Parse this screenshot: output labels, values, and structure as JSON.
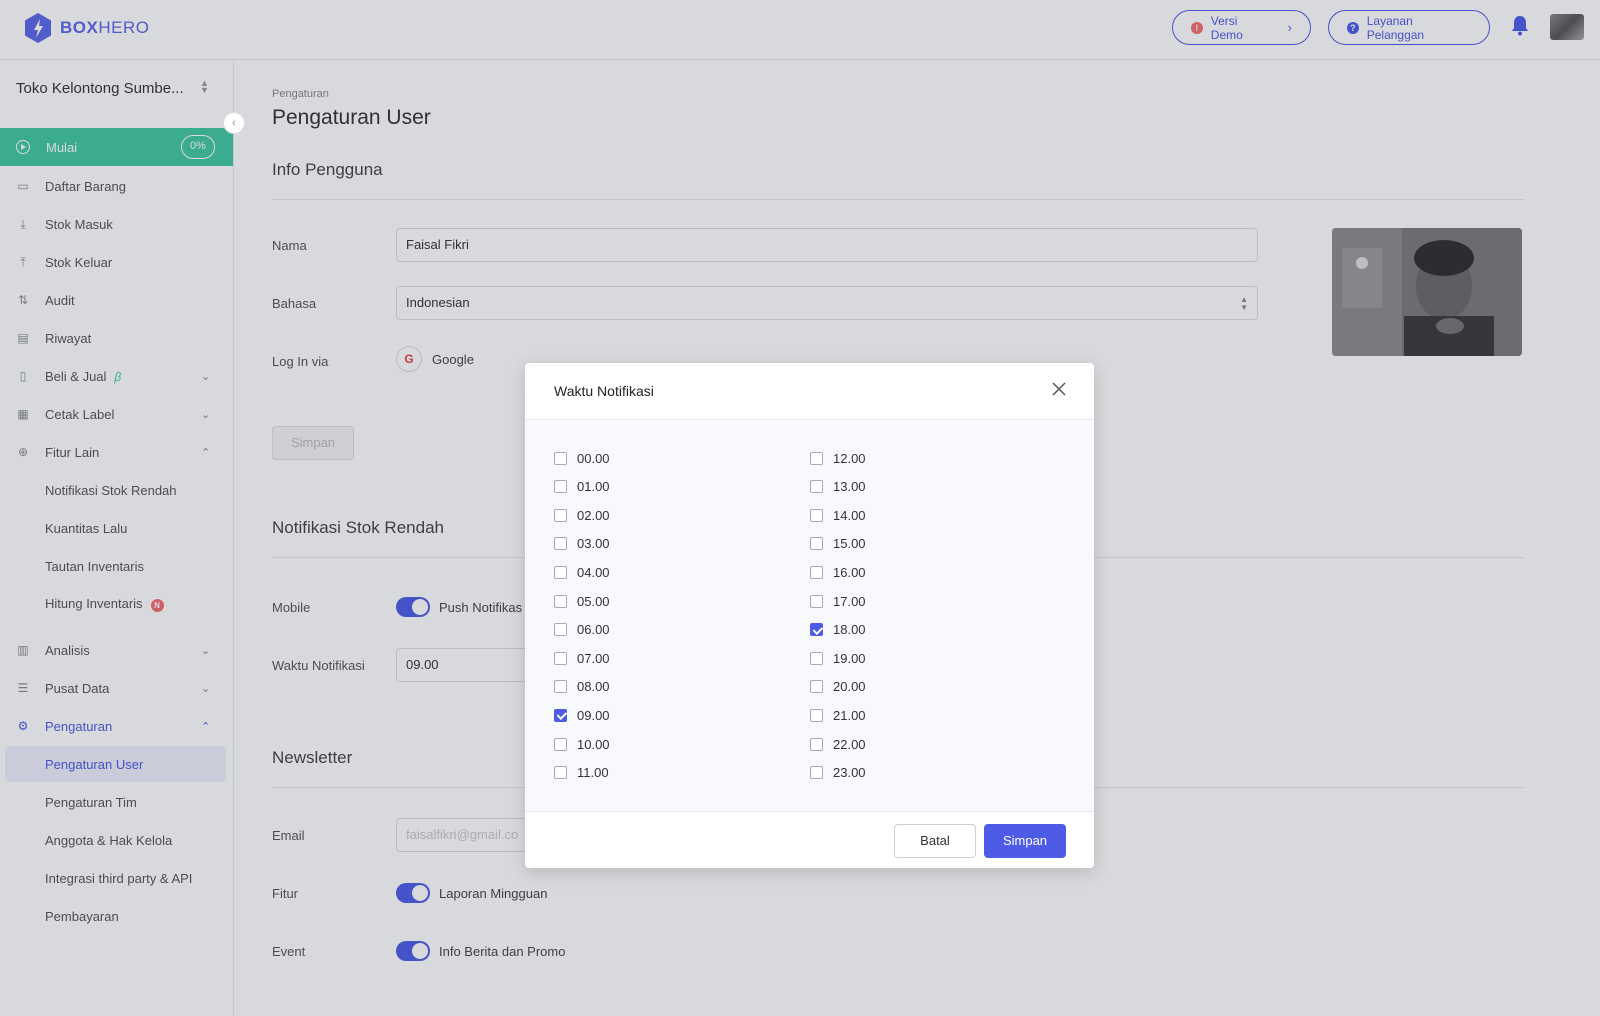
{
  "brand": {
    "name_bold": "BOX",
    "name_light": "HERO"
  },
  "header": {
    "demo_label": "Versi Demo",
    "support_label": "Layanan Pelanggan"
  },
  "sidebar": {
    "store_name": "Toko Kelontong Sumbe...",
    "start": {
      "label": "Mulai",
      "progress": "0%"
    },
    "items": [
      {
        "label": "Daftar Barang"
      },
      {
        "label": "Stok Masuk"
      },
      {
        "label": "Stok Keluar"
      },
      {
        "label": "Audit"
      },
      {
        "label": "Riwayat"
      },
      {
        "label": "Beli & Jual",
        "tag": "β"
      },
      {
        "label": "Cetak Label"
      },
      {
        "label": "Fitur Lain"
      },
      {
        "label": "Notifikasi Stok Rendah"
      },
      {
        "label": "Kuantitas Lalu"
      },
      {
        "label": "Tautan Inventaris"
      },
      {
        "label": "Hitung Inventaris",
        "badge": "N"
      },
      {
        "label": "Analisis"
      },
      {
        "label": "Pusat Data"
      },
      {
        "label": "Pengaturan"
      },
      {
        "label": "Pengaturan User"
      },
      {
        "label": "Pengaturan Tim"
      },
      {
        "label": "Anggota & Hak Kelola"
      },
      {
        "label": "Integrasi third party & API"
      },
      {
        "label": "Pembayaran"
      }
    ]
  },
  "main": {
    "breadcrumb": "Pengaturan",
    "title": "Pengaturan User",
    "user_info": {
      "title": "Info Pengguna",
      "name_label": "Nama",
      "name_value": "Faisal Fikri",
      "language_label": "Bahasa",
      "language_value": "Indonesian",
      "login_label": "Log In via",
      "login_provider": "Google",
      "google_glyph": "G",
      "save_label": "Simpan"
    },
    "low_stock": {
      "title": "Notifikasi Stok Rendah",
      "mobile_label": "Mobile",
      "push_label": "Push Notifikas",
      "time_label": "Waktu Notifikasi",
      "time_value": "09.00"
    },
    "newsletter": {
      "title": "Newsletter",
      "email_label": "Email",
      "email_value": "faisalfikri@gmail.co",
      "feature_label": "Fitur",
      "feature_toggle": "Laporan Mingguan",
      "event_label": "Event",
      "event_toggle": "Info Berita dan Promo"
    }
  },
  "modal": {
    "title": "Waktu Notifikasi",
    "hours": [
      {
        "label": "00.00",
        "checked": false
      },
      {
        "label": "01.00",
        "checked": false
      },
      {
        "label": "02.00",
        "checked": false
      },
      {
        "label": "03.00",
        "checked": false
      },
      {
        "label": "04.00",
        "checked": false
      },
      {
        "label": "05.00",
        "checked": false
      },
      {
        "label": "06.00",
        "checked": false
      },
      {
        "label": "07.00",
        "checked": false
      },
      {
        "label": "08.00",
        "checked": false
      },
      {
        "label": "09.00",
        "checked": true
      },
      {
        "label": "10.00",
        "checked": false
      },
      {
        "label": "11.00",
        "checked": false
      },
      {
        "label": "12.00",
        "checked": false
      },
      {
        "label": "13.00",
        "checked": false
      },
      {
        "label": "14.00",
        "checked": false
      },
      {
        "label": "15.00",
        "checked": false
      },
      {
        "label": "16.00",
        "checked": false
      },
      {
        "label": "17.00",
        "checked": false
      },
      {
        "label": "18.00",
        "checked": true
      },
      {
        "label": "19.00",
        "checked": false
      },
      {
        "label": "20.00",
        "checked": false
      },
      {
        "label": "21.00",
        "checked": false
      },
      {
        "label": "22.00",
        "checked": false
      },
      {
        "label": "23.00",
        "checked": false
      }
    ],
    "cancel_label": "Batal",
    "save_label": "Simpan"
  },
  "colors": {
    "accent": "#4e5be6",
    "start_green": "#40c9a2",
    "badge_red": "#f56c6c"
  },
  "icons": {
    "close": "close-icon",
    "bell": "bell-icon",
    "chevron": "chevron-down-icon"
  }
}
